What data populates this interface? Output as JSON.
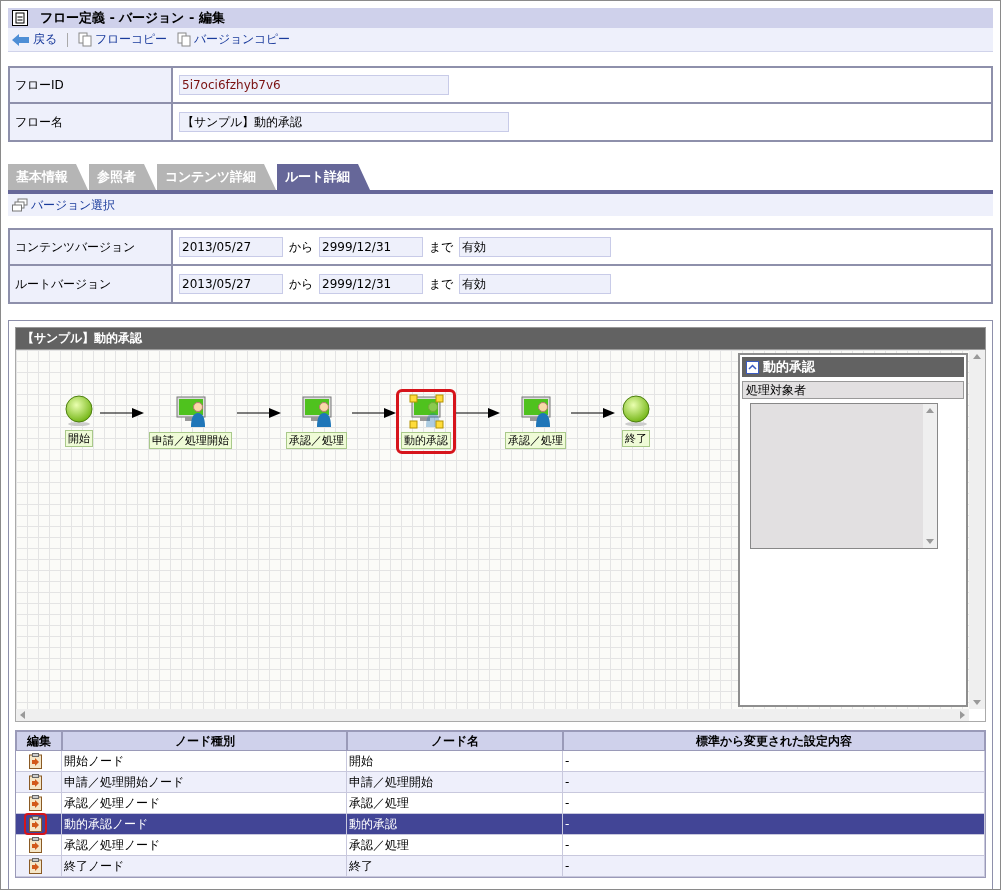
{
  "window": {
    "title": "フロー定義 - バージョン - 編集"
  },
  "toolbar": [
    {
      "label": "戻る",
      "kind": "back"
    },
    {
      "label": "フローコピー",
      "kind": "copy"
    },
    {
      "label": "バージョンコピー",
      "kind": "copy"
    }
  ],
  "flow_info": [
    {
      "label": "フローID",
      "value": "5i7oci6fzhyb7v6"
    },
    {
      "label": "フロー名",
      "value": "【サンプル】動的承認"
    }
  ],
  "tabs": [
    {
      "label": "基本情報",
      "selected": false
    },
    {
      "label": "参照者",
      "selected": false
    },
    {
      "label": "コンテンツ詳細",
      "selected": false
    },
    {
      "label": "ルート詳細",
      "selected": true
    }
  ],
  "version_select": "バージョン選択",
  "versions": [
    {
      "label": "コンテンツバージョン",
      "from": "2013/05/27",
      "from_word": "から",
      "to": "2999/12/31",
      "to_word": "まで",
      "status": "有効"
    },
    {
      "label": "ルートバージョン",
      "from": "2013/05/27",
      "from_word": "から",
      "to": "2999/12/31",
      "to_word": "まで",
      "status": "有効"
    }
  ],
  "diagram": {
    "title": "【サンプル】動的承認",
    "nodes": [
      {
        "label": "開始",
        "kind": "start",
        "selected": false,
        "marked": false
      },
      {
        "label": "申請／処理開始",
        "kind": "task",
        "selected": false,
        "marked": false
      },
      {
        "label": "承認／処理",
        "kind": "task",
        "selected": false,
        "marked": false
      },
      {
        "label": "動的承認",
        "kind": "dynamic",
        "selected": true,
        "marked": true
      },
      {
        "label": "承認／処理",
        "kind": "task",
        "selected": false,
        "marked": false
      },
      {
        "label": "終了",
        "kind": "end",
        "selected": false,
        "marked": false
      }
    ],
    "properties": {
      "title": "動的承認",
      "section": "処理対象者"
    }
  },
  "node_table": {
    "columns": [
      "編集",
      "ノード種別",
      "ノード名",
      "標準から変更された設定内容"
    ],
    "rows": [
      {
        "type": "開始ノード",
        "name": "開始",
        "changes": "-",
        "selected": false,
        "marked": false
      },
      {
        "type": "申請／処理開始ノード",
        "name": "申請／処理開始",
        "changes": "-",
        "selected": false,
        "marked": false
      },
      {
        "type": "承認／処理ノード",
        "name": "承認／処理",
        "changes": "-",
        "selected": false,
        "marked": false
      },
      {
        "type": "動的承認ノード",
        "name": "動的承認",
        "changes": "-",
        "selected": true,
        "marked": true
      },
      {
        "type": "承認／処理ノード",
        "name": "承認／処理",
        "changes": "-",
        "selected": false,
        "marked": false
      },
      {
        "type": "終了ノード",
        "name": "終了",
        "changes": "-",
        "selected": false,
        "marked": false
      }
    ]
  }
}
